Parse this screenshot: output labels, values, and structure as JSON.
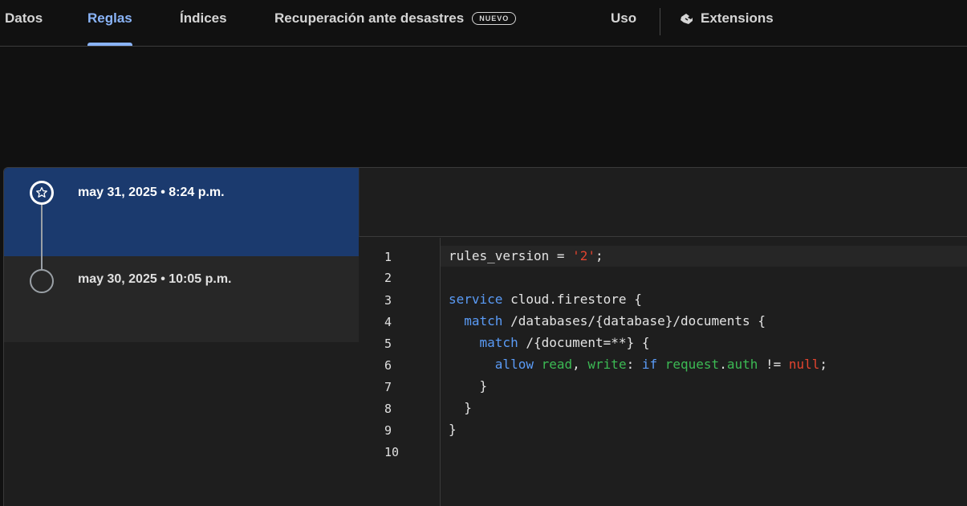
{
  "tabs": [
    {
      "label": "Datos",
      "active": false
    },
    {
      "label": "Reglas",
      "active": true
    },
    {
      "label": "Índices",
      "active": false
    },
    {
      "label": "Recuperación ante desastres",
      "badge": "NUEVO",
      "active": false
    },
    {
      "label": "Uso",
      "active": false
    },
    {
      "label": "Extensions",
      "icon": "extensions-icon",
      "active": false
    }
  ],
  "history": [
    {
      "label": "may 31, 2025 • 8:24 p.m.",
      "selected": true,
      "icon": "star-icon"
    },
    {
      "label": "may 30, 2025 • 10:05 p.m.",
      "selected": false,
      "icon": "circle-icon"
    }
  ],
  "editor": {
    "line_numbers": [
      "1",
      "2",
      "3",
      "4",
      "5",
      "6",
      "7",
      "8",
      "9",
      "10"
    ],
    "code": {
      "l1_a": "rules_version = ",
      "l1_str": "'2'",
      "l1_b": ";",
      "l3_kw": "service",
      "l3_rest": " cloud.firestore {",
      "l4_indent": "  ",
      "l4_kw": "match",
      "l4_rest": " /databases/{database}/documents {",
      "l5_indent": "    ",
      "l5_kw": "match",
      "l5_rest": " /{document=**} {",
      "l6_indent": "      ",
      "l6_kw": "allow",
      "l6_sp": " ",
      "l6_read": "read",
      "l6_comma": ", ",
      "l6_write": "write",
      "l6_colon": ": ",
      "l6_if": "if",
      "l6_sp2": " ",
      "l6_request": "request",
      "l6_dot": ".",
      "l6_auth": "auth",
      "l6_ne": " != ",
      "l6_null": "null",
      "l6_semi": ";",
      "l7": "    }",
      "l8": "  }",
      "l9": "}"
    }
  },
  "colors": {
    "accent": "#8ab4f8",
    "selected_bg": "#1b3a6e",
    "keyword": "#5a9bf6",
    "string": "#e2442f",
    "identifier_green": "#3cba54"
  }
}
